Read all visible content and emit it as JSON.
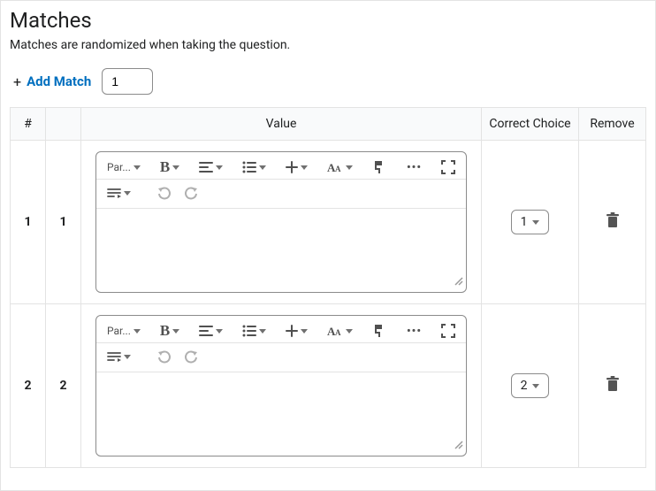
{
  "title": "Matches",
  "subtitle": "Matches are randomized when taking the question.",
  "add_match": {
    "plus": "+",
    "label": "Add Match",
    "count": "1"
  },
  "headers": {
    "num": "#",
    "id": "",
    "value": "Value",
    "choice": "Correct Choice",
    "remove": "Remove"
  },
  "editor_toolbar": {
    "paragraph": "Par...",
    "bold": "B",
    "more": "•••"
  },
  "rows": [
    {
      "num": "1",
      "id": "1",
      "choice": "1"
    },
    {
      "num": "2",
      "id": "2",
      "choice": "2"
    }
  ]
}
